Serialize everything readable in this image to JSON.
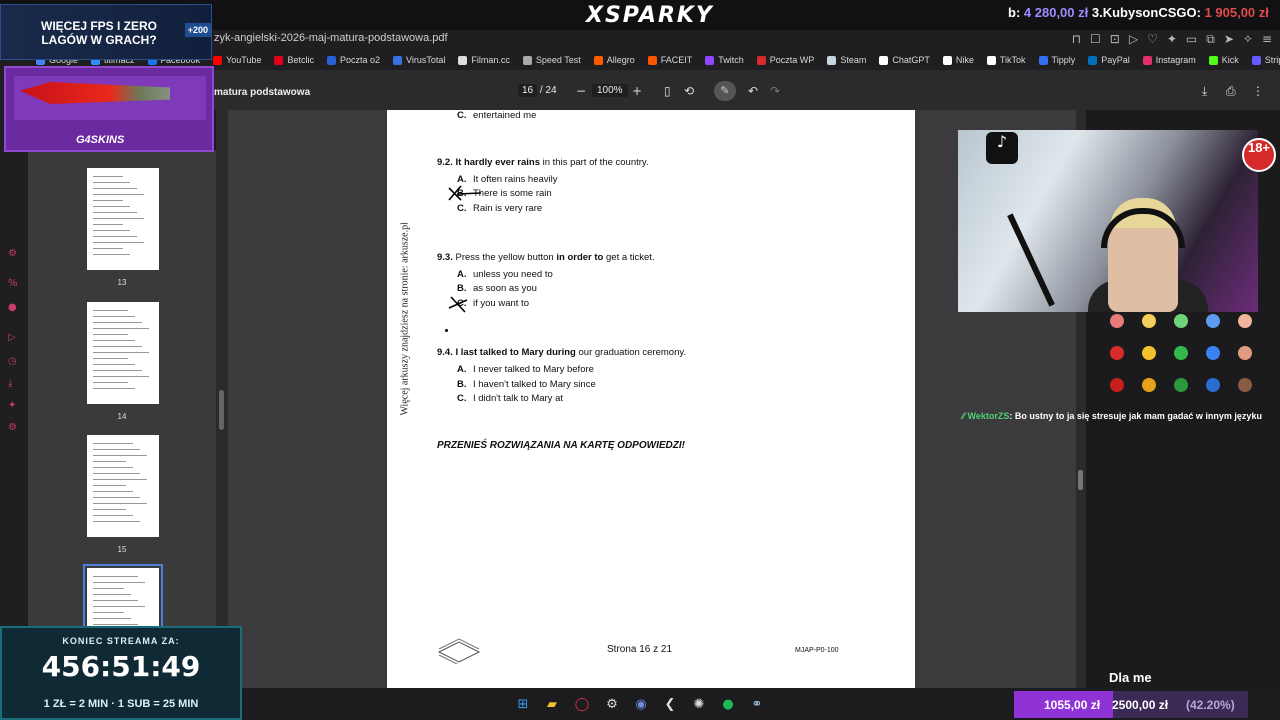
{
  "header": {
    "brand": "XSPARKY",
    "ticker_prefix": "b:",
    "ticker_amount": "4 280,00 zł",
    "ticker_rank": "3.KubysonCSGO:",
    "ticker_amount2": "1 905,00 zł"
  },
  "browser": {
    "url": "zyk-angielski-2026-maj-matura-podstawowa.pdf",
    "bookmarks": [
      {
        "label": "Google",
        "color": "#4285f4"
      },
      {
        "label": "titlmacz",
        "color": "#2d8cff"
      },
      {
        "label": "Facebook",
        "color": "#1877f2"
      },
      {
        "label": "YouTube",
        "color": "#ff0000"
      },
      {
        "label": "Betclic",
        "color": "#e3001b"
      },
      {
        "label": "Poczta o2",
        "color": "#2b5fd9"
      },
      {
        "label": "VirusTotal",
        "color": "#3a6fe0"
      },
      {
        "label": "Filman.cc",
        "color": "#dddddd"
      },
      {
        "label": "Speed Test",
        "color": "#aaaaaa"
      },
      {
        "label": "Allegro",
        "color": "#ff5a00"
      },
      {
        "label": "FACEIT",
        "color": "#ff5500"
      },
      {
        "label": "Twitch",
        "color": "#9146ff"
      },
      {
        "label": "Poczta WP",
        "color": "#d62b2b"
      },
      {
        "label": "Steam",
        "color": "#c7d5e0"
      },
      {
        "label": "ChatGPT",
        "color": "#ffffff"
      },
      {
        "label": "Nike",
        "color": "#ffffff"
      },
      {
        "label": "TikTok",
        "color": "#ffffff"
      },
      {
        "label": "Tipply",
        "color": "#2f6ff0"
      },
      {
        "label": "PayPal",
        "color": "#0070ba"
      },
      {
        "label": "Instagram",
        "color": "#e1306c"
      },
      {
        "label": "Kick",
        "color": "#53fc18"
      },
      {
        "label": "Stripe",
        "color": "#635bff"
      }
    ]
  },
  "pdf": {
    "title": "matura podstawowa",
    "page_current": "16",
    "page_total": "/ 24",
    "zoom": "100%",
    "thumbs": [
      {
        "label": "13"
      },
      {
        "label": "14"
      },
      {
        "label": "15"
      },
      {
        "label": ""
      }
    ]
  },
  "document": {
    "side_text": "Więcej arkuszy znajdziesz na stronie: arkusze.pl",
    "prev_opt_letter": "C.",
    "prev_opt_text": "entertained me",
    "q92_num": "9.2.",
    "q92_bold": "It hardly ever rains",
    "q92_rest": "in this part of the country.",
    "q92_a": "It often rains heavily",
    "q92_b": "There is some rain",
    "q92_c": "Rain is very rare",
    "q93_num": "9.3.",
    "q93_pre": "Press the yellow button",
    "q93_bold": "in order to",
    "q93_rest": "get a ticket.",
    "q93_a": "unless you need to",
    "q93_b": "as soon as you",
    "q93_c": "if you want to",
    "q94_num": "9.4.",
    "q94_bold": "I last talked to Mary during",
    "q94_rest": "our graduation ceremony.",
    "q94_a": "I never talked to Mary before",
    "q94_b": "I haven't talked to Mary since",
    "q94_c": "I didn't talk to Mary at",
    "letter_a": "A.",
    "letter_b": "B.",
    "letter_c": "C.",
    "note": "PRZENIEŚ ROZWIĄZANIA NA KARTĘ ODPOWIEDZI!",
    "page_num": "Strona 16 z 21",
    "code": "MJAP-P0-100"
  },
  "overlay": {
    "promo_line1": "WIĘCEJ FPS I ZERO",
    "promo_line2": "LAGÓW W GRACH?",
    "promo_badge": "+200",
    "promo2_logo": "G4SKINS",
    "age": "18+",
    "chat_user": "WektorZS",
    "chat_msg": ": Bo ustny to ja się stresuje jak mam gadać w innym języku",
    "dla_me": "Dla me",
    "timer_label": "KONIEC STREAMA ZA:",
    "timer_value": "456:51:49",
    "timer_rate": "1 ZŁ = 2 MIN  · 1 SUB = 25 MIN",
    "goal_current": "1055,00 zł",
    "goal_target": "2500,00 zł",
    "goal_percent": "(42.20%)",
    "goal_fraction": 0.422,
    "palette": [
      "#e87a7a",
      "#f2cf5a",
      "#6fd47a",
      "#5b9af0",
      "#f0b49a",
      "#d92b2b",
      "#f2c12b",
      "#35b84a",
      "#3b82f0",
      "#e09a80",
      "#c81e1e",
      "#e6a21a",
      "#2a9a3c",
      "#2a6fd0",
      "#8a5a45"
    ]
  }
}
